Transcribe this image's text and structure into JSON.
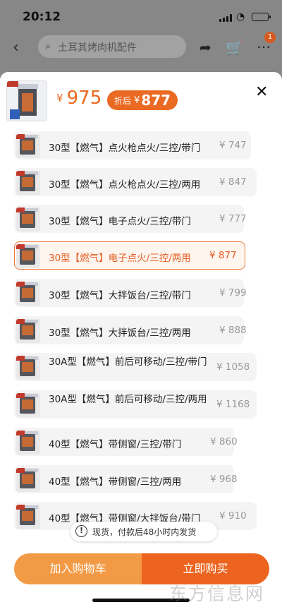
{
  "status": {
    "time": "20:12"
  },
  "nav": {
    "search_text": "土耳其烤肉机配件",
    "cart_badge": "1"
  },
  "header": {
    "currency": "¥",
    "price": "975",
    "discount_label": "折后",
    "discount_price": "877"
  },
  "options": [
    {
      "name": "30型【燃气】点火枪点火/三控/带门",
      "price": "¥ 747",
      "selected": false
    },
    {
      "name": "30型【燃气】点火枪点火/三控/两用",
      "price": "¥ 847",
      "selected": false
    },
    {
      "name": "30型【燃气】电子点火/三控/带门",
      "price": "¥ 777",
      "selected": false
    },
    {
      "name": "30型【燃气】电子点火/三控/两用",
      "price": "¥ 877",
      "selected": true
    },
    {
      "name": "30型【燃气】大拌饭台/三控/带门",
      "price": "¥ 799",
      "selected": false
    },
    {
      "name": "30型【燃气】大拌饭台/三控/两用",
      "price": "¥ 888",
      "selected": false
    },
    {
      "name": "30A型【燃气】前后可移动/三控/带门",
      "price": "¥ 1058",
      "selected": false
    },
    {
      "name": "30A型【燃气】前后可移动/三控/两用",
      "price": "¥ 1168",
      "selected": false
    },
    {
      "name": "40型【燃气】带侧窗/三控/带门",
      "price": "¥ 860",
      "selected": false
    },
    {
      "name": "40型【燃气】带侧窗/三控/两用",
      "price": "¥ 968",
      "selected": false
    },
    {
      "name": "40型【燃气】带侧窗/大拌饭台/带门",
      "price": "¥ 910",
      "selected": false
    }
  ],
  "notice": {
    "icon": "!",
    "text": "现货，付款后48小时内发货"
  },
  "actions": {
    "add_to_cart": "加入购物车",
    "buy_now": "立即购买"
  },
  "watermark": "东方信息网",
  "colors": {
    "accent": "#ec6420",
    "add_cart": "#f29a45",
    "selected_border": "#ea7a3e"
  }
}
